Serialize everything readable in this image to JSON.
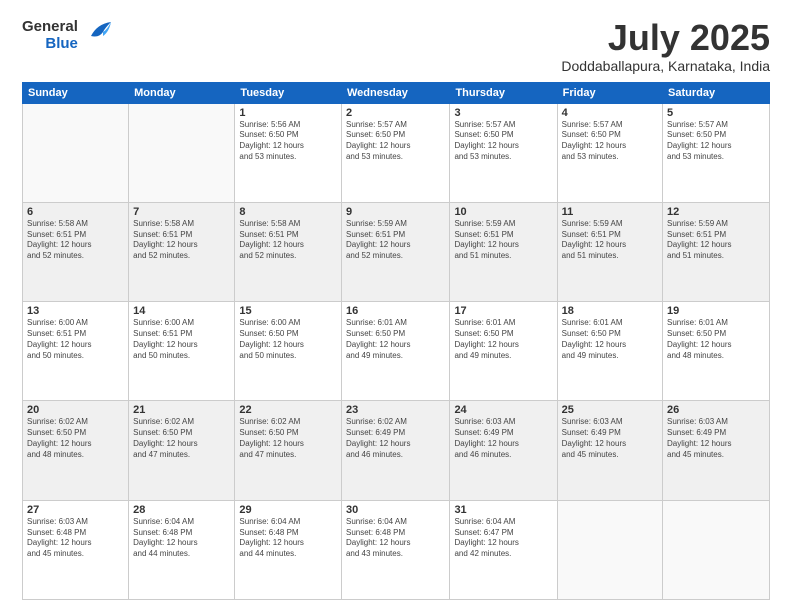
{
  "header": {
    "logo_line1": "General",
    "logo_line2": "Blue",
    "month_title": "July 2025",
    "location": "Doddaballapura, Karnataka, India"
  },
  "weekdays": [
    "Sunday",
    "Monday",
    "Tuesday",
    "Wednesday",
    "Thursday",
    "Friday",
    "Saturday"
  ],
  "weeks": [
    [
      {
        "day": "",
        "info": ""
      },
      {
        "day": "",
        "info": ""
      },
      {
        "day": "1",
        "info": "Sunrise: 5:56 AM\nSunset: 6:50 PM\nDaylight: 12 hours\nand 53 minutes."
      },
      {
        "day": "2",
        "info": "Sunrise: 5:57 AM\nSunset: 6:50 PM\nDaylight: 12 hours\nand 53 minutes."
      },
      {
        "day": "3",
        "info": "Sunrise: 5:57 AM\nSunset: 6:50 PM\nDaylight: 12 hours\nand 53 minutes."
      },
      {
        "day": "4",
        "info": "Sunrise: 5:57 AM\nSunset: 6:50 PM\nDaylight: 12 hours\nand 53 minutes."
      },
      {
        "day": "5",
        "info": "Sunrise: 5:57 AM\nSunset: 6:50 PM\nDaylight: 12 hours\nand 53 minutes."
      }
    ],
    [
      {
        "day": "6",
        "info": "Sunrise: 5:58 AM\nSunset: 6:51 PM\nDaylight: 12 hours\nand 52 minutes."
      },
      {
        "day": "7",
        "info": "Sunrise: 5:58 AM\nSunset: 6:51 PM\nDaylight: 12 hours\nand 52 minutes."
      },
      {
        "day": "8",
        "info": "Sunrise: 5:58 AM\nSunset: 6:51 PM\nDaylight: 12 hours\nand 52 minutes."
      },
      {
        "day": "9",
        "info": "Sunrise: 5:59 AM\nSunset: 6:51 PM\nDaylight: 12 hours\nand 52 minutes."
      },
      {
        "day": "10",
        "info": "Sunrise: 5:59 AM\nSunset: 6:51 PM\nDaylight: 12 hours\nand 51 minutes."
      },
      {
        "day": "11",
        "info": "Sunrise: 5:59 AM\nSunset: 6:51 PM\nDaylight: 12 hours\nand 51 minutes."
      },
      {
        "day": "12",
        "info": "Sunrise: 5:59 AM\nSunset: 6:51 PM\nDaylight: 12 hours\nand 51 minutes."
      }
    ],
    [
      {
        "day": "13",
        "info": "Sunrise: 6:00 AM\nSunset: 6:51 PM\nDaylight: 12 hours\nand 50 minutes."
      },
      {
        "day": "14",
        "info": "Sunrise: 6:00 AM\nSunset: 6:51 PM\nDaylight: 12 hours\nand 50 minutes."
      },
      {
        "day": "15",
        "info": "Sunrise: 6:00 AM\nSunset: 6:50 PM\nDaylight: 12 hours\nand 50 minutes."
      },
      {
        "day": "16",
        "info": "Sunrise: 6:01 AM\nSunset: 6:50 PM\nDaylight: 12 hours\nand 49 minutes."
      },
      {
        "day": "17",
        "info": "Sunrise: 6:01 AM\nSunset: 6:50 PM\nDaylight: 12 hours\nand 49 minutes."
      },
      {
        "day": "18",
        "info": "Sunrise: 6:01 AM\nSunset: 6:50 PM\nDaylight: 12 hours\nand 49 minutes."
      },
      {
        "day": "19",
        "info": "Sunrise: 6:01 AM\nSunset: 6:50 PM\nDaylight: 12 hours\nand 48 minutes."
      }
    ],
    [
      {
        "day": "20",
        "info": "Sunrise: 6:02 AM\nSunset: 6:50 PM\nDaylight: 12 hours\nand 48 minutes."
      },
      {
        "day": "21",
        "info": "Sunrise: 6:02 AM\nSunset: 6:50 PM\nDaylight: 12 hours\nand 47 minutes."
      },
      {
        "day": "22",
        "info": "Sunrise: 6:02 AM\nSunset: 6:50 PM\nDaylight: 12 hours\nand 47 minutes."
      },
      {
        "day": "23",
        "info": "Sunrise: 6:02 AM\nSunset: 6:49 PM\nDaylight: 12 hours\nand 46 minutes."
      },
      {
        "day": "24",
        "info": "Sunrise: 6:03 AM\nSunset: 6:49 PM\nDaylight: 12 hours\nand 46 minutes."
      },
      {
        "day": "25",
        "info": "Sunrise: 6:03 AM\nSunset: 6:49 PM\nDaylight: 12 hours\nand 45 minutes."
      },
      {
        "day": "26",
        "info": "Sunrise: 6:03 AM\nSunset: 6:49 PM\nDaylight: 12 hours\nand 45 minutes."
      }
    ],
    [
      {
        "day": "27",
        "info": "Sunrise: 6:03 AM\nSunset: 6:48 PM\nDaylight: 12 hours\nand 45 minutes."
      },
      {
        "day": "28",
        "info": "Sunrise: 6:04 AM\nSunset: 6:48 PM\nDaylight: 12 hours\nand 44 minutes."
      },
      {
        "day": "29",
        "info": "Sunrise: 6:04 AM\nSunset: 6:48 PM\nDaylight: 12 hours\nand 44 minutes."
      },
      {
        "day": "30",
        "info": "Sunrise: 6:04 AM\nSunset: 6:48 PM\nDaylight: 12 hours\nand 43 minutes."
      },
      {
        "day": "31",
        "info": "Sunrise: 6:04 AM\nSunset: 6:47 PM\nDaylight: 12 hours\nand 42 minutes."
      },
      {
        "day": "",
        "info": ""
      },
      {
        "day": "",
        "info": ""
      }
    ]
  ]
}
